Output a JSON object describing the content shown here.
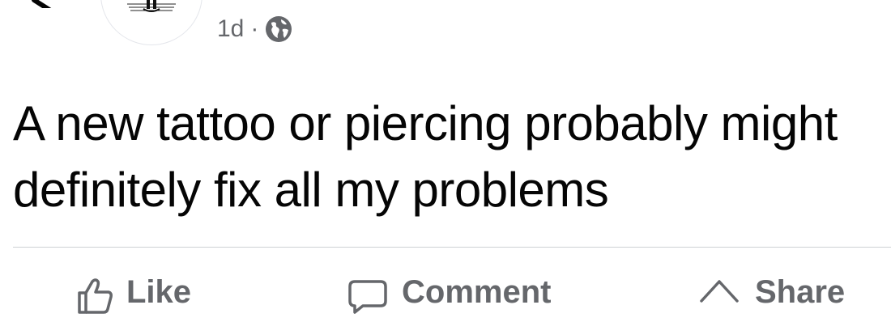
{
  "header": {
    "timestamp": "1d",
    "separator": "·",
    "audience_icon": "globe-icon",
    "back_icon": "chevron-left-icon",
    "avatar_icon": "avatar-image"
  },
  "post": {
    "text": "A new tattoo or piercing probably might definitely fix all my problems"
  },
  "actions": {
    "like_label": "Like",
    "comment_label": "Comment",
    "share_label": "Share"
  },
  "colors": {
    "text_primary": "#050505",
    "text_secondary": "#65676b",
    "divider": "#ced0d4"
  }
}
